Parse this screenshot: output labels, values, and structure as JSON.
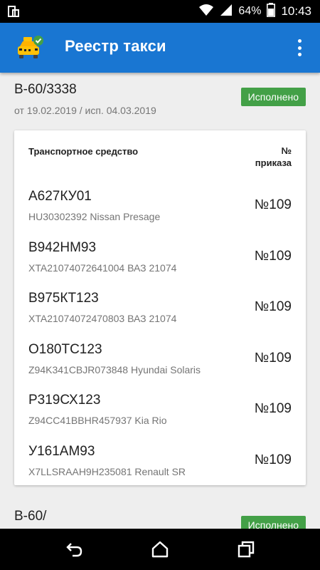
{
  "status_bar": {
    "battery_percent": "64%",
    "time": "10:43",
    "icons": [
      "screen-mirror-icon",
      "wifi-icon",
      "signal-icon",
      "battery-icon"
    ]
  },
  "app_bar": {
    "title": "Реестр такси",
    "logo_icon": "taxi-check-icon",
    "menu_icon": "more-vert-icon",
    "color": "#1976d2"
  },
  "registry": {
    "number": "В-60/3338",
    "dates": "от 19.02.2019 / исп. 04.03.2019",
    "status": "Исполнено",
    "status_color": "#43a047",
    "table": {
      "col_vehicle": "Транспортное средство",
      "col_order": "№ приказа",
      "rows": [
        {
          "plate": "А627КУ01",
          "vin": "HU30302392 Nissan Presage",
          "order": "№109"
        },
        {
          "plate": "В942НМ93",
          "vin": "XTA21074072641004 ВАЗ 21074",
          "order": "№109"
        },
        {
          "plate": "В975КТ123",
          "vin": "XTA21074072470803 ВАЗ 21074",
          "order": "№109"
        },
        {
          "plate": "О180ТС123",
          "vin": "Z94K341CBJR073848 Hyundai Solaris",
          "order": "№109"
        },
        {
          "plate": "Р319СХ123",
          "vin": "Z94CC41BBHR457937 Kia Rio",
          "order": "№109"
        },
        {
          "plate": "У161АМ93",
          "vin": "X7LLSRAAH9H235081 Renault SR",
          "order": "№109"
        }
      ]
    }
  },
  "next_registry": {
    "number": "В-60/",
    "status": "Исполнено"
  },
  "nav_bar": {
    "icons": [
      "back-icon",
      "home-icon",
      "recent-apps-icon"
    ]
  }
}
